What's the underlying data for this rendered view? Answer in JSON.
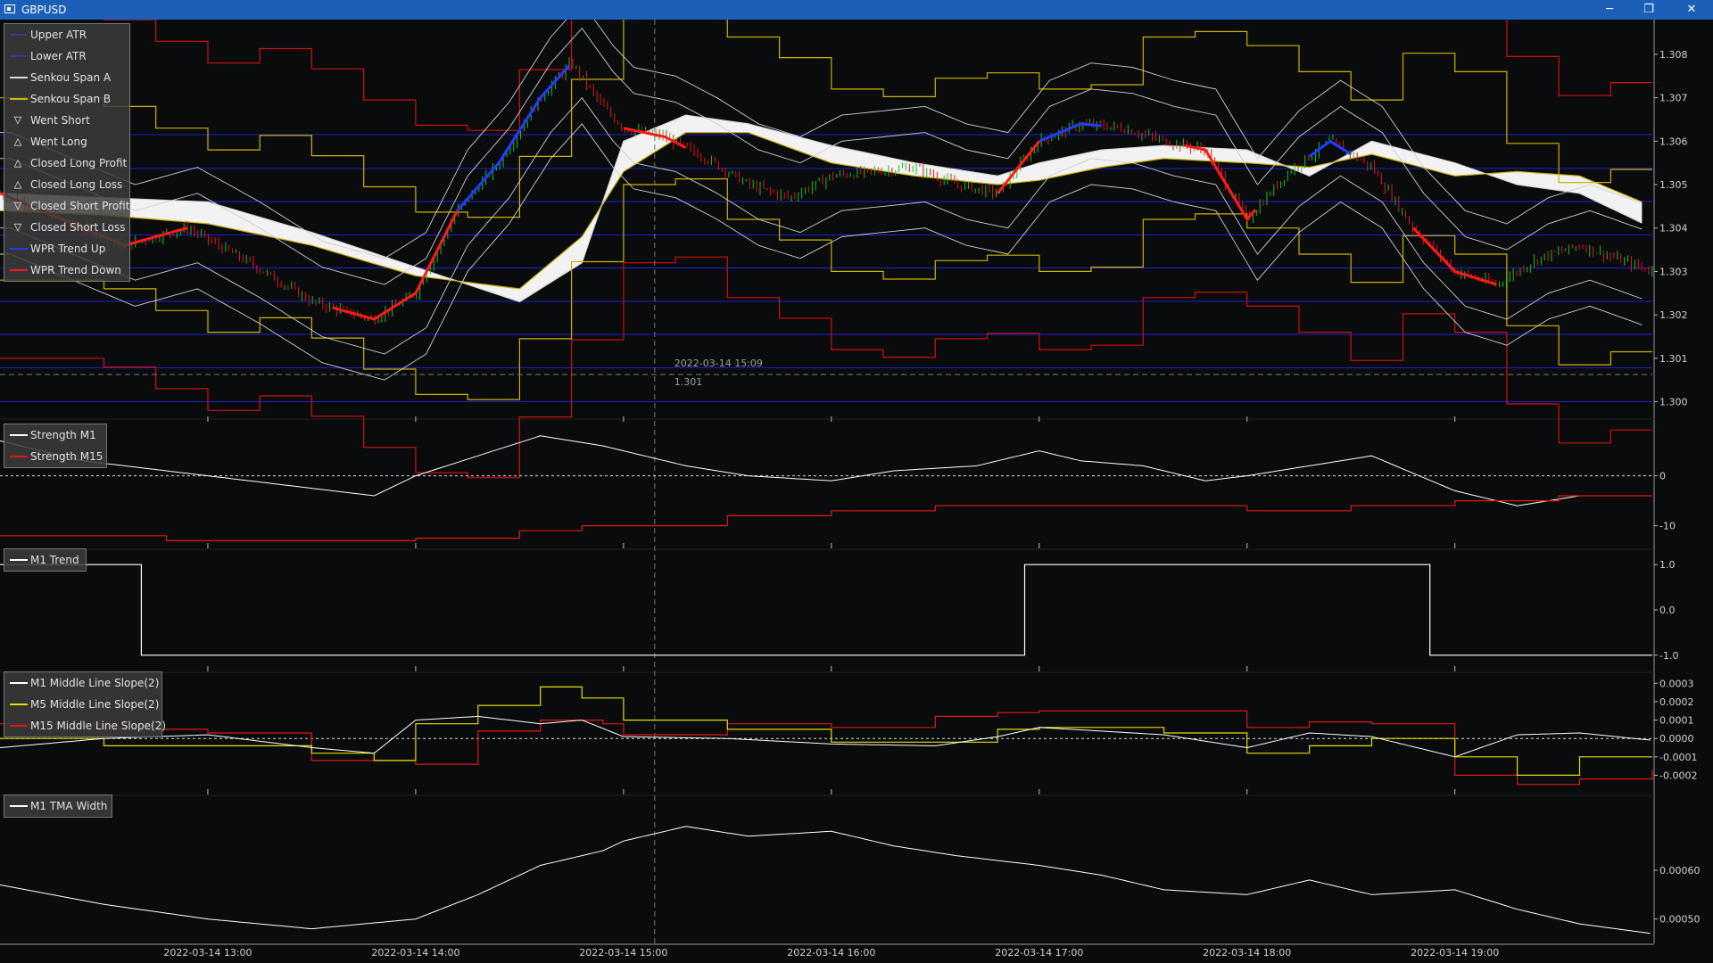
{
  "window": {
    "title": "GBPUSD",
    "minimize": "─",
    "maximize": "❐",
    "close": "✕"
  },
  "crosshair": {
    "time": "2022-03-14 15:09",
    "price": "1.301"
  },
  "x_axis": {
    "ticks": [
      "2022-03-14 13:00",
      "2022-03-14 14:00",
      "2022-03-14 15:00",
      "2022-03-14 16:00",
      "2022-03-14 17:00",
      "2022-03-14 18:00",
      "2022-03-14 19:00"
    ]
  },
  "colors": {
    "background": "#0a0b0d",
    "bull": "#19c319",
    "bear": "#e01818",
    "wpr_up": "#1f3cff",
    "wpr_down": "#ff1a1a",
    "senkou_a": "#d9d9d9",
    "senkou_b": "#c9b400",
    "cloud": "#ffffff",
    "red_line": "#d01010",
    "blue_line": "#2020d0",
    "titlebar": "#1c5fb8"
  },
  "legends": {
    "main": [
      {
        "label": "Upper ATR",
        "icon": "line",
        "color": "#3a3a8a"
      },
      {
        "label": "Lower ATR",
        "icon": "line",
        "color": "#3a3a8a"
      },
      {
        "label": "Senkou Span A",
        "icon": "line",
        "color": "#d9d9d9"
      },
      {
        "label": "Senkou Span B",
        "icon": "line",
        "color": "#c9b400"
      },
      {
        "label": "Went Short",
        "icon": "triangle-down-icon",
        "color": "#ffffff"
      },
      {
        "label": "Went Long",
        "icon": "triangle-up-icon",
        "color": "#ffffff"
      },
      {
        "label": "Closed Long Profit",
        "icon": "triangle-up-icon",
        "color": "#ffffff"
      },
      {
        "label": "Closed Long Loss",
        "icon": "triangle-up-icon",
        "color": "#ffffff"
      },
      {
        "label": "Closed Short Profit",
        "icon": "triangle-down-icon",
        "color": "#ffffff"
      },
      {
        "label": "Closed Short Loss",
        "icon": "triangle-down-icon",
        "color": "#ffffff"
      },
      {
        "label": "WPR Trend Up",
        "icon": "line",
        "color": "#1f3cff"
      },
      {
        "label": "WPR Trend Down",
        "icon": "line",
        "color": "#ff1a1a"
      }
    ],
    "strength": [
      {
        "label": "Strength M1",
        "icon": "line",
        "color": "#ffffff"
      },
      {
        "label": "Strength M15",
        "icon": "line",
        "color": "#e01818"
      }
    ],
    "trend": [
      {
        "label": "M1 Trend",
        "icon": "line",
        "color": "#ffffff"
      }
    ],
    "slope": [
      {
        "label": "M1 Middle Line Slope(2)",
        "icon": "line",
        "color": "#ffffff"
      },
      {
        "label": "M5 Middle Line Slope(2)",
        "icon": "line",
        "color": "#e0e000"
      },
      {
        "label": "M15 Middle Line Slope(2)",
        "icon": "line",
        "color": "#e01818"
      }
    ],
    "tma": [
      {
        "label": "M1 TMA Width",
        "icon": "line",
        "color": "#ffffff"
      }
    ]
  },
  "chart_data": [
    {
      "type": "line",
      "title": "",
      "pane": "price",
      "ylim": [
        1.2996,
        1.3088
      ],
      "y_ticks": [
        "1.308",
        "1.307",
        "1.306",
        "1.305",
        "1.304",
        "1.303",
        "1.302",
        "1.301",
        "1.300"
      ],
      "y_tick_values": [
        1.308,
        1.307,
        1.306,
        1.305,
        1.304,
        1.303,
        1.302,
        1.301,
        1.3
      ],
      "x_range_hours": [
        12.0,
        19.95
      ],
      "horizontal_lines": [
        1.30615,
        1.30537,
        1.30461,
        1.30384,
        1.30308,
        1.30231,
        1.30155,
        1.30078,
        1.3
      ],
      "series": [
        {
          "name": "Close",
          "x": [
            12.0,
            12.3,
            12.6,
            12.9,
            13.2,
            13.5,
            13.8,
            14.0,
            14.2,
            14.4,
            14.6,
            14.75,
            14.9,
            15.0,
            15.2,
            15.4,
            15.6,
            15.8,
            16.0,
            16.2,
            16.4,
            16.6,
            16.8,
            17.0,
            17.2,
            17.4,
            17.6,
            17.8,
            18.0,
            18.2,
            18.4,
            18.6,
            18.8,
            19.0,
            19.2,
            19.4,
            19.6,
            19.95
          ],
          "values": [
            1.3048,
            1.3042,
            1.3036,
            1.304,
            1.3032,
            1.3023,
            1.3019,
            1.3025,
            1.3044,
            1.3055,
            1.307,
            1.3078,
            1.3068,
            1.3063,
            1.3061,
            1.3056,
            1.305,
            1.3047,
            1.3052,
            1.3053,
            1.3054,
            1.305,
            1.3048,
            1.306,
            1.3064,
            1.3063,
            1.306,
            1.3058,
            1.3042,
            1.3053,
            1.306,
            1.3054,
            1.304,
            1.303,
            1.3027,
            1.3033,
            1.3036,
            1.303
          ]
        },
        {
          "name": "Senkou Span A",
          "x": [
            12.0,
            12.5,
            13.0,
            13.5,
            14.0,
            14.5,
            14.8,
            15.0,
            15.3,
            15.6,
            16.0,
            16.4,
            16.8,
            17.0,
            17.3,
            17.6,
            18.0,
            18.3,
            18.6,
            19.0,
            19.3,
            19.6,
            19.95
          ],
          "values": [
            1.3048,
            1.3047,
            1.3046,
            1.3039,
            1.3031,
            1.3023,
            1.3032,
            1.306,
            1.3066,
            1.3064,
            1.3059,
            1.3055,
            1.3052,
            1.3055,
            1.3058,
            1.3059,
            1.3058,
            1.3052,
            1.306,
            1.3055,
            1.305,
            1.3048,
            1.304
          ]
        },
        {
          "name": "Senkou Span B",
          "x": [
            12.0,
            12.5,
            13.0,
            13.5,
            14.0,
            14.5,
            14.8,
            15.0,
            15.3,
            15.6,
            16.0,
            16.4,
            16.8,
            17.0,
            17.3,
            17.6,
            18.0,
            18.3,
            18.6,
            19.0,
            19.3,
            19.6,
            19.95
          ],
          "values": [
            1.3044,
            1.3043,
            1.3041,
            1.3036,
            1.3029,
            1.3026,
            1.3038,
            1.3053,
            1.3062,
            1.3062,
            1.3055,
            1.3052,
            1.305,
            1.3051,
            1.3054,
            1.3056,
            1.3055,
            1.3054,
            1.3057,
            1.3052,
            1.3053,
            1.3052,
            1.3045
          ]
        },
        {
          "name": "Strength M1",
          "x": [
            12.0,
            12.4,
            12.8,
            13.0,
            13.4,
            13.8,
            14.0,
            14.3,
            14.6,
            14.9,
            15.0,
            15.3,
            15.6,
            16.0,
            16.3,
            16.7,
            17.0,
            17.2,
            17.5,
            17.8,
            18.0,
            18.3,
            18.6,
            19.0,
            19.3,
            19.6,
            19.95
          ],
          "values": [
            7,
            3,
            1,
            0,
            -2,
            -4,
            0,
            4,
            8,
            6,
            5,
            2,
            0,
            -1,
            1,
            2,
            5,
            3,
            2,
            -1,
            0,
            2,
            4,
            -3,
            -6,
            -4,
            -4
          ]
        },
        {
          "name": "Strength M15",
          "x": [
            12.0,
            12.8,
            13.5,
            14.0,
            14.5,
            14.8,
            15.5,
            16.0,
            16.5,
            17.0,
            17.5,
            18.0,
            18.5,
            19.0,
            19.5,
            19.95
          ],
          "values": [
            -12,
            -13,
            -13,
            -12.5,
            -11,
            -10,
            -8,
            -7,
            -6,
            -6,
            -6,
            -7,
            -6,
            -5,
            -4,
            -4
          ]
        },
        {
          "name": "M1 Trend",
          "x": [
            12.0,
            12.68,
            12.68,
            16.93,
            16.93,
            18.88,
            18.88,
            19.95
          ],
          "values": [
            1,
            1,
            -1,
            -1,
            1,
            1,
            -1,
            -1
          ]
        },
        {
          "name": "M1 Middle Line Slope(2)",
          "x": [
            12.0,
            12.5,
            13.0,
            13.5,
            13.8,
            14.0,
            14.3,
            14.6,
            14.8,
            15.0,
            15.5,
            16.0,
            16.5,
            16.8,
            17.0,
            17.3,
            17.6,
            18.0,
            18.3,
            18.6,
            19.0,
            19.3,
            19.6,
            19.95
          ],
          "values": [
            -5e-05,
            0.0,
            2e-05,
            -5e-05,
            -8e-05,
            0.0001,
            0.00012,
            8e-05,
            0.0001,
            1e-05,
            0.0,
            -3e-05,
            -4e-05,
            1e-05,
            6e-05,
            4e-05,
            2e-05,
            -5e-05,
            3e-05,
            1e-05,
            -0.0001,
            2e-05,
            3e-05,
            -1e-05
          ]
        },
        {
          "name": "M5 Middle Line Slope(2)",
          "x": [
            12.0,
            12.5,
            13.0,
            13.5,
            13.8,
            14.0,
            14.3,
            14.6,
            14.8,
            15.0,
            15.5,
            16.0,
            16.5,
            16.8,
            17.0,
            17.3,
            17.6,
            18.0,
            18.3,
            18.6,
            19.0,
            19.3,
            19.6,
            19.95
          ],
          "values": [
            0.0,
            -4e-05,
            -4e-05,
            -8e-05,
            -0.00012,
            8e-05,
            0.00018,
            0.00028,
            0.00022,
            0.0001,
            5e-05,
            -2e-05,
            -2e-05,
            5e-05,
            6e-05,
            6e-05,
            3e-05,
            -8e-05,
            -4e-05,
            0.0,
            -0.0001,
            -0.0002,
            -0.0001,
            -0.0001
          ]
        },
        {
          "name": "M15 Middle Line Slope(2)",
          "x": [
            12.0,
            12.5,
            13.0,
            13.5,
            14.0,
            14.3,
            14.6,
            14.9,
            15.0,
            15.5,
            16.0,
            16.5,
            16.8,
            17.0,
            17.5,
            18.0,
            18.3,
            18.6,
            19.0,
            19.3,
            19.6,
            19.95
          ],
          "values": [
            8e-05,
            5e-05,
            3e-05,
            -0.00012,
            -0.00014,
            4e-05,
            0.0001,
            8e-05,
            2e-05,
            8e-05,
            6e-05,
            0.00012,
            0.00014,
            0.00015,
            0.00015,
            6e-05,
            9e-05,
            8e-05,
            -0.0002,
            -0.00025,
            -0.00022,
            -0.00017
          ]
        },
        {
          "name": "M1 TMA Width",
          "x": [
            12.0,
            12.5,
            13.0,
            13.5,
            14.0,
            14.3,
            14.6,
            14.9,
            15.0,
            15.3,
            15.6,
            16.0,
            16.3,
            16.6,
            17.0,
            17.3,
            17.6,
            18.0,
            18.3,
            18.6,
            19.0,
            19.3,
            19.6,
            19.95
          ],
          "values": [
            0.00057,
            0.00053,
            0.0005,
            0.00048,
            0.0005,
            0.00055,
            0.00061,
            0.00064,
            0.00066,
            0.00069,
            0.00067,
            0.00068,
            0.00065,
            0.00063,
            0.00061,
            0.00059,
            0.00056,
            0.00055,
            0.00058,
            0.00055,
            0.00056,
            0.00052,
            0.00049,
            0.00047
          ]
        }
      ]
    }
  ],
  "pane_axes": {
    "strength": {
      "ticks": [
        "0",
        "-10"
      ],
      "tick_values": [
        0,
        -10
      ],
      "ylim": [
        -14,
        11
      ]
    },
    "trend": {
      "ticks": [
        "1.0",
        "0.0",
        "-1.0"
      ],
      "tick_values": [
        1,
        0,
        -1
      ],
      "ylim": [
        -1.3,
        1.3
      ]
    },
    "slope": {
      "ticks": [
        "0.0003",
        "0.0002",
        "0.0001",
        "0.0000",
        "-0.0001",
        "-0.0002"
      ],
      "tick_values": [
        0.0003,
        0.0002,
        0.0001,
        0,
        -0.0001,
        -0.0002
      ],
      "ylim": [
        -0.00029,
        0.00035
      ]
    },
    "tma": {
      "ticks": [
        "0.00060",
        "0.00050"
      ],
      "tick_values": [
        0.0006,
        0.0005
      ],
      "ylim": [
        0.00045,
        0.00075
      ]
    }
  }
}
